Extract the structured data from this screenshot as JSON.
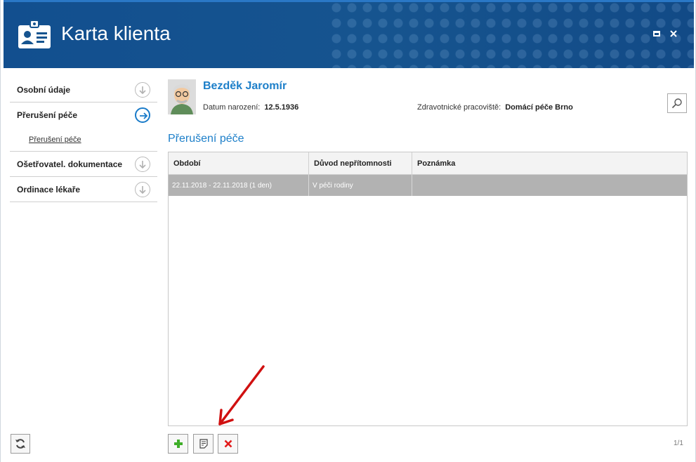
{
  "window": {
    "title": "Karta klienta",
    "colors": {
      "header": "#16548f",
      "accent": "#1d7fc9",
      "selected_row": "#b2b2b2",
      "add": "#3fae29",
      "delete": "#e21b1b",
      "annotation_arrow": "#d01010"
    }
  },
  "sidebar": {
    "items": [
      {
        "label": "Osobní údaje",
        "icon": "chevron-down-circle-icon"
      },
      {
        "label": "Přerušení péče",
        "icon": "arrow-right-circle-icon",
        "sub": "Přerušení péče"
      },
      {
        "label": "Ošetřovatel. dokumentace",
        "icon": "chevron-down-circle-icon"
      },
      {
        "label": "Ordinace lékaře",
        "icon": "chevron-down-circle-icon"
      }
    ]
  },
  "client": {
    "name": "Bezděk Jaromír",
    "dob_label": "Datum narození:",
    "dob": "12.5.1936",
    "workplace_label": "Zdravotnické pracoviště:",
    "workplace": "Domácí péče Brno"
  },
  "section": {
    "title": "Přerušení péče"
  },
  "grid": {
    "columns": [
      "Období",
      "Důvod nepřítomnosti",
      "Poznámka"
    ],
    "rows": [
      [
        "22.11.2018 - 22.11.2018 (1 den)",
        "V péči rodiny",
        ""
      ]
    ]
  },
  "pager": "1/1"
}
